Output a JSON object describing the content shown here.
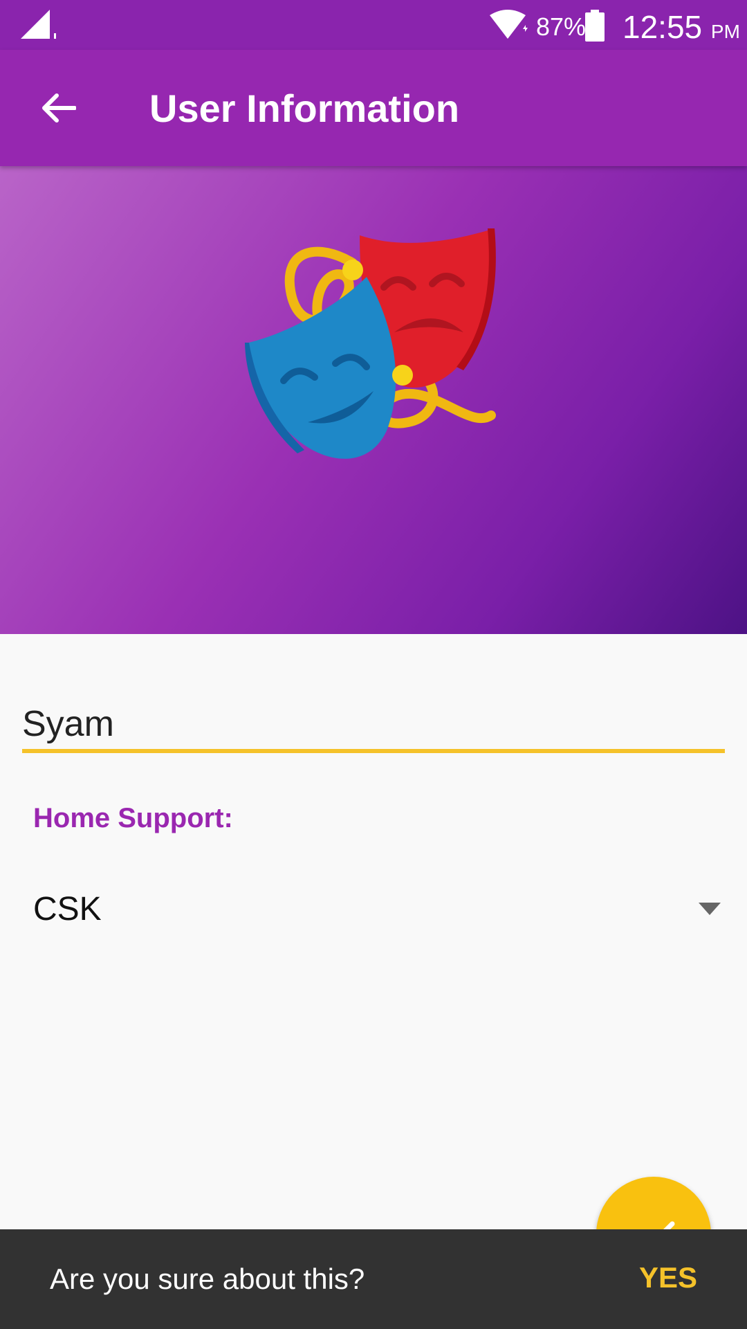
{
  "status_bar": {
    "battery_percent": "87%",
    "time": "12:55",
    "ampm": "PM",
    "icons": [
      "signal-icon",
      "wifi-icon",
      "battery-icon"
    ]
  },
  "app_bar": {
    "title": "User Information",
    "back_icon": "arrow-back-icon",
    "color": "#9627b0"
  },
  "header": {
    "image": "theater-masks-icon"
  },
  "form": {
    "name_value": "Syam",
    "accent_color": "#f5c22a",
    "home_support_label": "Home Support:",
    "home_support_selected": "CSK"
  },
  "fab": {
    "icon": "check-icon",
    "color": "#f9c10f"
  },
  "snackbar": {
    "message": "Are you sure about this?",
    "action": "YES"
  }
}
